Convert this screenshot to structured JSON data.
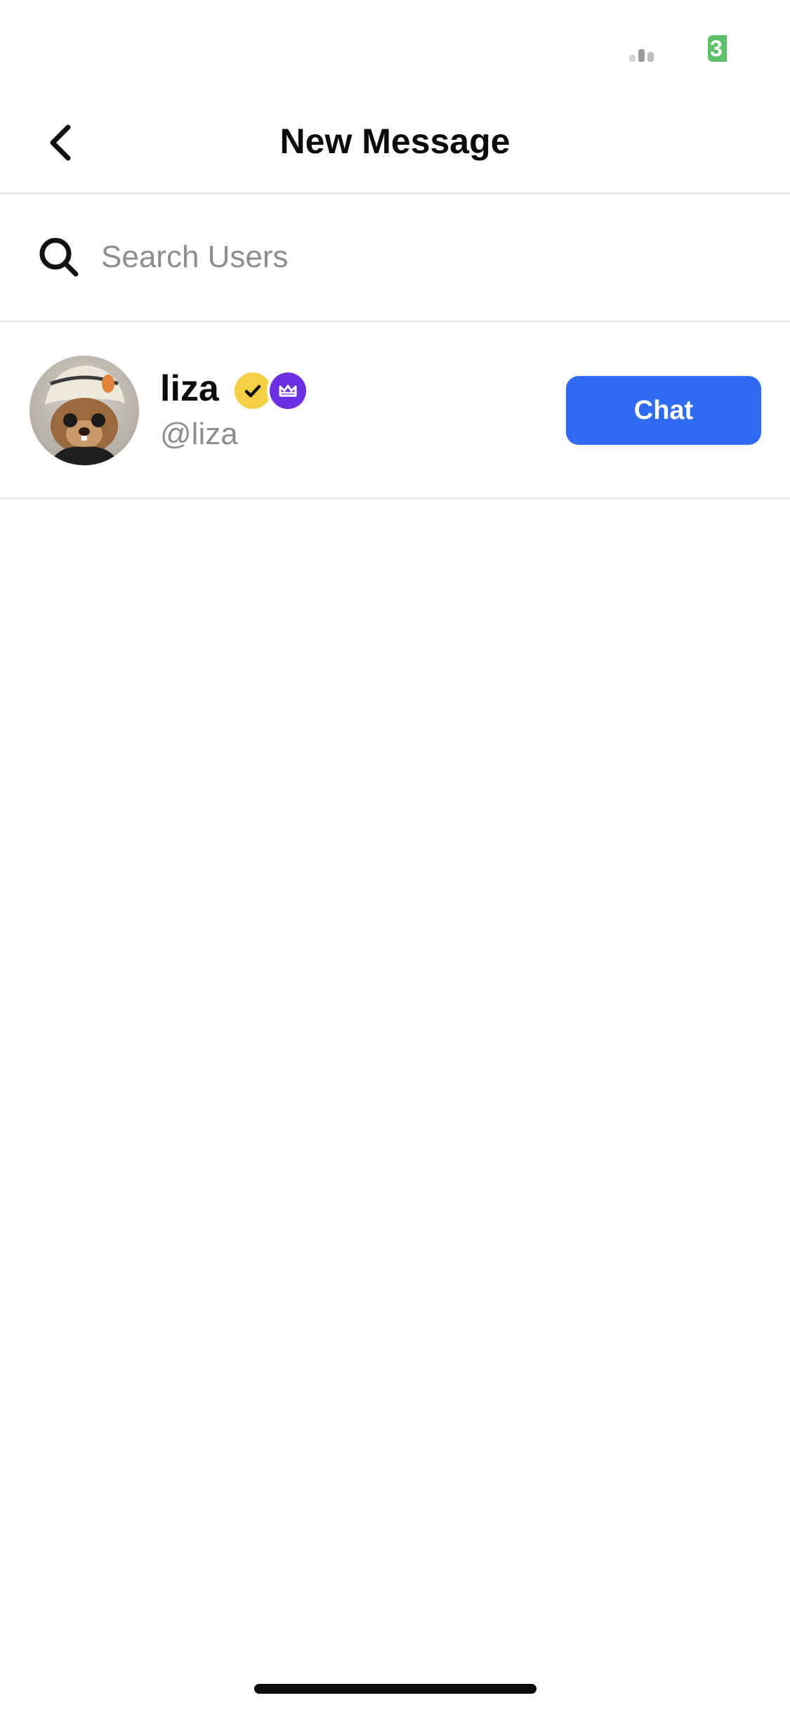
{
  "status_bar": {
    "battery_text": "3",
    "battery_color": "#5fc06a",
    "signal_icon": "signal-bars-icon"
  },
  "header": {
    "back_icon": "chevron-left-icon",
    "title": "New Message"
  },
  "search": {
    "icon": "search-icon",
    "placeholder": "Search Users",
    "value": ""
  },
  "results": [
    {
      "name": "liza",
      "handle": "@liza",
      "avatar_icon": "avatar-image",
      "badges": [
        {
          "icon": "verified-check-icon",
          "color": "#f5cf46"
        },
        {
          "icon": "crown-icon",
          "color": "#6b2ee0"
        }
      ],
      "action_label": "Chat",
      "action_color": "#2f6bf0"
    }
  ]
}
